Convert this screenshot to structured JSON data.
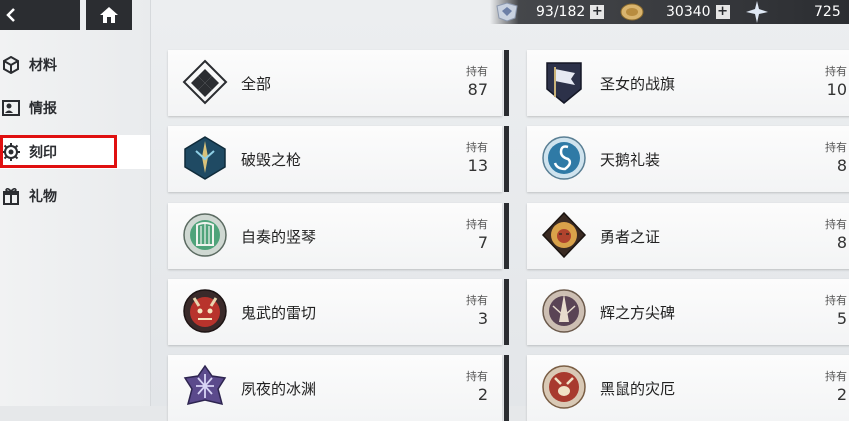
{
  "nav": {
    "back_icon": "back-arrow-icon",
    "home_icon": "home-icon"
  },
  "resources": [
    {
      "icon": "stamina-icon",
      "value": "93/182"
    },
    {
      "icon": "coin-icon",
      "value": "30340"
    },
    {
      "icon": "crystal-icon",
      "value": "725"
    }
  ],
  "sidebar": {
    "items": [
      {
        "label": "材料",
        "icon": "cube-icon"
      },
      {
        "label": "情报",
        "icon": "profile-card-icon"
      },
      {
        "label": "刻印",
        "icon": "seal-gear-icon",
        "active": true
      },
      {
        "label": "礼物",
        "icon": "gift-icon"
      }
    ]
  },
  "cards": [
    {
      "name": "全部",
      "hold_label": "持有",
      "count": "87",
      "icon": "diamond-grid-icon"
    },
    {
      "name": "圣女的战旗",
      "hold_label": "持有",
      "count": "10",
      "icon": "banner-emblem-icon"
    },
    {
      "name": "破毁之枪",
      "hold_label": "持有",
      "count": "13",
      "icon": "spear-emblem-icon"
    },
    {
      "name": "天鹅礼装",
      "hold_label": "持有",
      "count": "8",
      "icon": "swan-emblem-icon"
    },
    {
      "name": "自奏的竖琴",
      "hold_label": "持有",
      "count": "7",
      "icon": "harp-emblem-icon"
    },
    {
      "name": "勇者之证",
      "hold_label": "持有",
      "count": "8",
      "icon": "lion-emblem-icon"
    },
    {
      "name": "鬼武的雷切",
      "hold_label": "持有",
      "count": "3",
      "icon": "oni-mask-emblem-icon"
    },
    {
      "name": "辉之方尖碑",
      "hold_label": "持有",
      "count": "5",
      "icon": "obelisk-emblem-icon"
    },
    {
      "name": "夙夜的冰渊",
      "hold_label": "持有",
      "count": "2",
      "icon": "ice-emblem-icon"
    },
    {
      "name": "黑鼠的灾厄",
      "hold_label": "持有",
      "count": "2",
      "icon": "rat-emblem-icon"
    }
  ],
  "colors": {
    "highlight": "#e01010",
    "dark": "#2b2d31"
  }
}
